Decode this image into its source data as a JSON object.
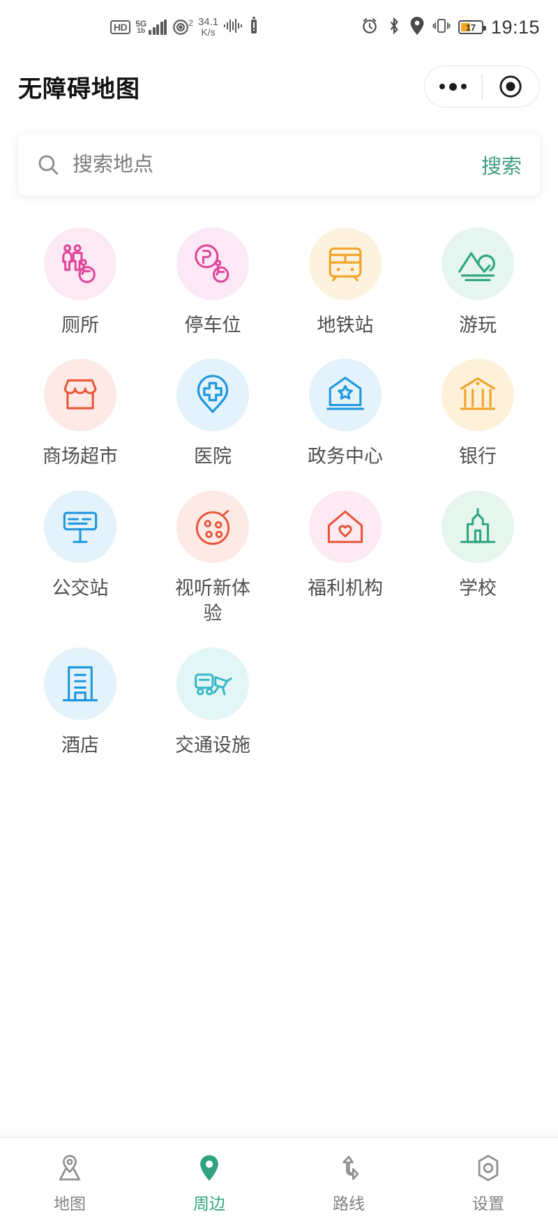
{
  "status_bar": {
    "hd_label": "HD",
    "network_label": "5G",
    "network_sub": "1b",
    "wifi_badge": "2",
    "net_speed_value": "34.1",
    "net_speed_unit": "K/s",
    "battery_percent": "17",
    "clock": "19:15",
    "icons": [
      "hd-icon",
      "signal-icon",
      "wifi-icon",
      "network-speed",
      "audio-wave-icon",
      "vpn-icon",
      "alarm-icon",
      "bluetooth-icon",
      "location-icon",
      "vibrate-icon",
      "battery-icon"
    ]
  },
  "header": {
    "title": "无障碍地图",
    "capsule": {
      "more_label": "more-options",
      "close_label": "close-miniprogram"
    }
  },
  "search": {
    "placeholder": "搜索地点",
    "value": "",
    "button_label": "搜索",
    "button_color": "#3d9e82"
  },
  "categories": [
    {
      "label": "厕所",
      "icon": "toilet-accessible-icon",
      "bubble": "#fbe9f4",
      "stroke": "#e0479b"
    },
    {
      "label": "停车位",
      "icon": "parking-accessible-icon",
      "bubble": "#fce9f5",
      "stroke": "#e0479b"
    },
    {
      "label": "地铁站",
      "icon": "subway-icon",
      "bubble": "#fdf2dd",
      "stroke": "#f0a228"
    },
    {
      "label": "游玩",
      "icon": "mountain-play-icon",
      "bubble": "#e6f5f0",
      "stroke": "#2fa77f"
    },
    {
      "label": "商场超市",
      "icon": "shop-store-icon",
      "bubble": "#fdeae6",
      "stroke": "#e8563a"
    },
    {
      "label": "医院",
      "icon": "hospital-cross-icon",
      "bubble": "#e4f2fc",
      "stroke": "#1e97dd"
    },
    {
      "label": "政务中心",
      "icon": "government-star-icon",
      "bubble": "#e4f2fc",
      "stroke": "#1e97dd"
    },
    {
      "label": "银行",
      "icon": "bank-icon",
      "bubble": "#fdf1da",
      "stroke": "#f0a228"
    },
    {
      "label": "公交站",
      "icon": "bus-stop-icon",
      "bubble": "#e4f2fc",
      "stroke": "#1e97dd"
    },
    {
      "label": "视听新体验",
      "icon": "audio-visual-icon",
      "bubble": "#fdeae6",
      "stroke": "#e8563a"
    },
    {
      "label": "福利机构",
      "icon": "welfare-home-heart-icon",
      "bubble": "#fdeaf2",
      "stroke": "#e8563a"
    },
    {
      "label": "学校",
      "icon": "school-icon",
      "bubble": "#e6f5ed",
      "stroke": "#2fa77f"
    },
    {
      "label": "酒店",
      "icon": "hotel-building-icon",
      "bubble": "#e4f2fc",
      "stroke": "#1e97dd"
    },
    {
      "label": "交通设施",
      "icon": "transport-facility-icon",
      "bubble": "#e3f6f6",
      "stroke": "#36b8c6"
    }
  ],
  "tabbar": {
    "active_index": 1,
    "active_color": "#2fa37f",
    "inactive_color": "#808080",
    "items": [
      {
        "label": "地图",
        "icon": "map-pin-outline-icon"
      },
      {
        "label": "周边",
        "icon": "location-pin-filled-icon"
      },
      {
        "label": "路线",
        "icon": "route-arrow-icon"
      },
      {
        "label": "设置",
        "icon": "settings-gear-icon"
      }
    ]
  }
}
